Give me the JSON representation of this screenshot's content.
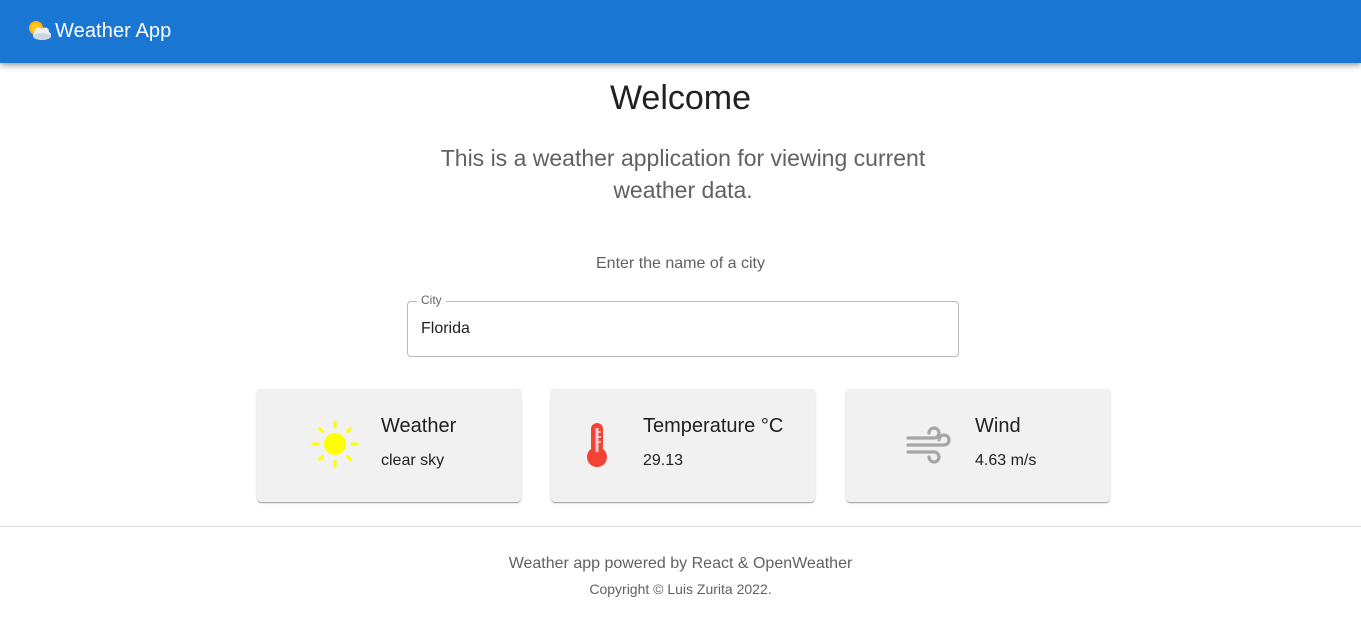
{
  "appbar": {
    "title": "Weather App",
    "logo_icon": "sun-behind-cloud-icon",
    "background": "#1976d2"
  },
  "hero": {
    "heading": "Welcome",
    "subtitle": "This is a weather application for viewing current weather data."
  },
  "search": {
    "prompt": "Enter the name of a city",
    "label": "City",
    "value": "Florida"
  },
  "cards": [
    {
      "icon": "sun-icon",
      "icon_color": "#ffff00",
      "title": "Weather",
      "value": "clear sky"
    },
    {
      "icon": "thermometer-icon",
      "icon_color": "#f44336",
      "title": "Temperature °C",
      "value": "29.13"
    },
    {
      "icon": "wind-icon",
      "icon_color": "#a6a6a6",
      "title": "Wind",
      "value": "4.63 m/s"
    }
  ],
  "footer": {
    "text": "Weather app powered by React & OpenWeather",
    "copyright": "Copyright © Luis Zurita 2022."
  }
}
